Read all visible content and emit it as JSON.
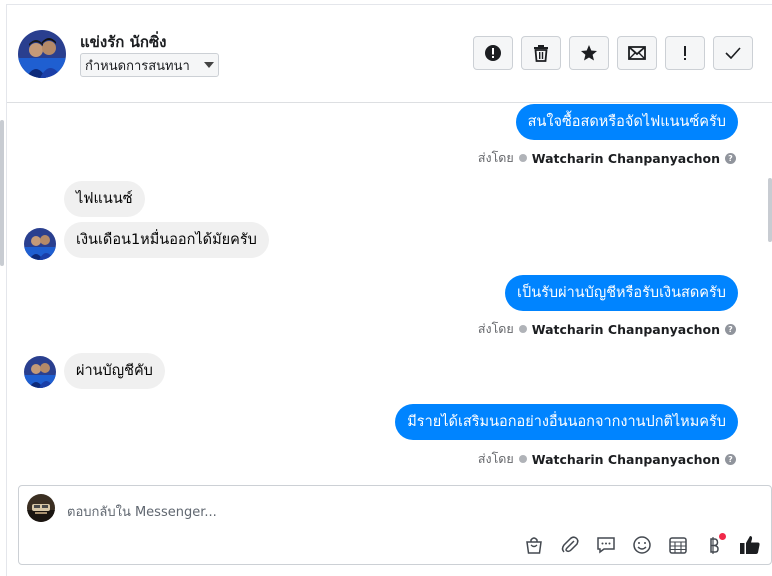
{
  "header": {
    "contact_name": "แข่งรัก นักซิ่ง",
    "label_select": "กำหนดการสนทนา",
    "toolbar": [
      {
        "name": "spam-button",
        "icon": "alert-circle-icon"
      },
      {
        "name": "delete-button",
        "icon": "trash-icon"
      },
      {
        "name": "star-button",
        "icon": "star-icon"
      },
      {
        "name": "mark-unread-button",
        "icon": "envelope-icon"
      },
      {
        "name": "follow-up-button",
        "icon": "exclamation-icon"
      },
      {
        "name": "done-button",
        "icon": "check-icon"
      }
    ]
  },
  "conversation": {
    "sent_by_label": "ส่งโดย",
    "sender_name": "Watcharin Chanpanyachon",
    "messages": [
      {
        "from": "page",
        "text": "สนใจซื้อสดหรือจัดไฟแนนซ์ครับ"
      },
      {
        "from": "customer",
        "text": "ไฟแนนซ์"
      },
      {
        "from": "customer",
        "text": "เงินเดือน1หมื่นออกได้มัยครับ"
      },
      {
        "from": "page",
        "text": "เป็นรับผ่านบัญชีหรือรับเงินสดครับ"
      },
      {
        "from": "customer",
        "text": "ผ่านบัญชีคับ"
      },
      {
        "from": "page",
        "text": "มีรายได้เสริมนอกอย่างอื่นนอกจากงานปกติไหมครับ"
      }
    ]
  },
  "composer": {
    "placeholder": "ตอบกลับใน Messenger...",
    "icons": [
      "shopping-bag-icon",
      "paperclip-icon",
      "saved-reply-icon",
      "emoji-icon",
      "appointment-icon",
      "payment-icon",
      "like-icon"
    ]
  },
  "colors": {
    "accent": "#0084ff",
    "incoming_bubble": "#f0f0f0",
    "notification_dot": "#f02849"
  }
}
